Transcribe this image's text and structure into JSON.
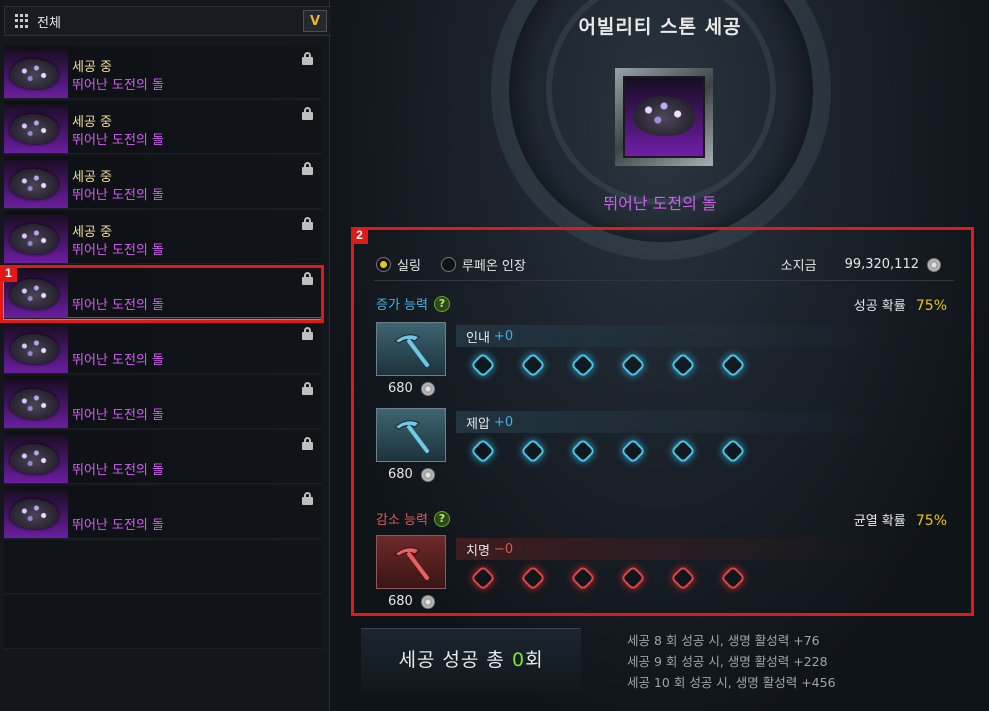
{
  "filter": {
    "label": "전체",
    "dropdown_glyph": "V",
    "grid_icon": "grid-icon"
  },
  "list": [
    {
      "status": "세공 중",
      "name": "뛰어난 도전의 돌",
      "selected": false
    },
    {
      "status": "세공 중",
      "name": "뛰어난 도전의 돌",
      "selected": false
    },
    {
      "status": "세공 중",
      "name": "뛰어난 도전의 돌",
      "selected": false
    },
    {
      "status": "세공 중",
      "name": "뛰어난 도전의 돌",
      "selected": false
    },
    {
      "status": "",
      "name": "뛰어난 도전의 돌",
      "selected": true
    },
    {
      "status": "",
      "name": "뛰어난 도전의 돌",
      "selected": false
    },
    {
      "status": "",
      "name": "뛰어난 도전의 돌",
      "selected": false
    },
    {
      "status": "",
      "name": "뛰어난 도전의 돌",
      "selected": false
    },
    {
      "status": "",
      "name": "뛰어난 도전의 돌",
      "selected": false
    }
  ],
  "annotations": {
    "badge1": "1",
    "badge2": "2"
  },
  "main": {
    "title": "어빌리티 스톤 세공",
    "item_name": "뛰어난 도전의 돌",
    "currency": {
      "option1": "실링",
      "option2": "루페온 인장",
      "holdings_label": "소지금",
      "holdings_value": "99,320,112"
    },
    "increase": {
      "label": "증가 능력",
      "rate_label": "성공 확률",
      "rate": "75%",
      "skills": [
        {
          "name": "인내",
          "value": "+0",
          "cost": "680"
        },
        {
          "name": "제압",
          "value": "+0",
          "cost": "680"
        }
      ]
    },
    "decrease": {
      "label": "감소 능력",
      "rate_label": "균열 확률",
      "rate": "75%",
      "skills": [
        {
          "name": "치명",
          "value": "−0",
          "cost": "680"
        }
      ]
    },
    "success": {
      "prefix": "세공 성공 총 ",
      "count": "0",
      "suffix": "회"
    },
    "bonus_lines": [
      "세공 8 회 성공 시, 생명 활성력 +76",
      "세공 9 회 성공 시, 생명 활성력 +228",
      "세공 10 회 성공 시, 생명 활성력 +456"
    ]
  },
  "colors": {
    "annotation_red": "#e01919",
    "item_purple": "#d05ef2",
    "status_yellow": "#f2dc9c",
    "rate_gold": "#f0c20e",
    "plus_blue": "#3ab2ef",
    "minus_red": "#d85858",
    "success_green": "#7de22f"
  }
}
